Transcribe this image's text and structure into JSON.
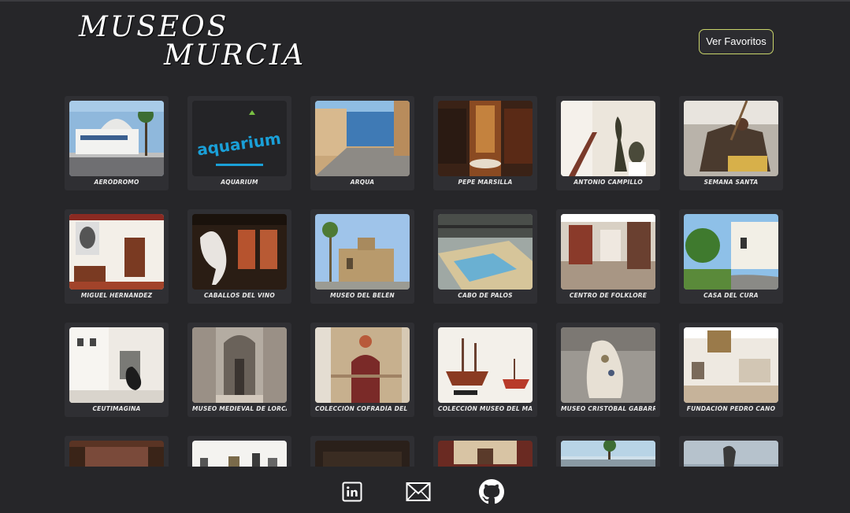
{
  "header": {
    "logo_line1": "MUSEOS",
    "logo_line2": "MURCIA",
    "favorites_button": "Ver Favoritos"
  },
  "gallery": {
    "museums": [
      {
        "label": "AERÓDROMO",
        "icon": "aerodrome-photo"
      },
      {
        "label": "AQUARIUM",
        "icon": "aquarium-logo",
        "logo_text": "aquarium"
      },
      {
        "label": "ARQUA",
        "icon": "arqua-photo"
      },
      {
        "label": "PEPE MARSILLA",
        "icon": "pepe-marsilla-photo"
      },
      {
        "label": "ANTONIO CAMPILLO",
        "icon": "antonio-campillo-photo"
      },
      {
        "label": "SEMANA SANTA",
        "icon": "semana-santa-photo"
      },
      {
        "label": "MIGUEL HERNÁNDEZ",
        "icon": "miguel-hernandez-photo"
      },
      {
        "label": "CABALLOS DEL VINO",
        "icon": "caballos-del-vino-photo"
      },
      {
        "label": "MUSEO DEL BELÉN",
        "icon": "museo-del-belen-photo"
      },
      {
        "label": "CABO DE PALOS",
        "icon": "cabo-de-palos-photo"
      },
      {
        "label": "CENTRO DE FOLKLORE",
        "icon": "centro-de-folklore-photo"
      },
      {
        "label": "CASA DEL CURA",
        "icon": "casa-del-cura-photo"
      },
      {
        "label": "CEUTIMAGINA",
        "icon": "ceutimagina-photo"
      },
      {
        "label": "MUSEO MEDIEVAL DE LORCA",
        "icon": "museo-medieval-lorca-photo"
      },
      {
        "label": "COLECCIÓN COFRADÍA DEL ROLLO",
        "icon": "cofradia-del-rollo-photo"
      },
      {
        "label": "COLECCIÓN MUSEO DEL MAR",
        "icon": "museo-del-mar-photo"
      },
      {
        "label": "MUSEO CRISTÓBAL GABARRÓN",
        "icon": "cristobal-gabarron-photo"
      },
      {
        "label": "FUNDACIÓN PEDRO CANO",
        "icon": "pedro-cano-photo"
      },
      {
        "label": "",
        "icon": "museum-photo-19"
      },
      {
        "label": "",
        "icon": "museum-photo-20"
      },
      {
        "label": "",
        "icon": "museum-photo-21"
      },
      {
        "label": "",
        "icon": "museum-photo-22"
      },
      {
        "label": "",
        "icon": "museum-photo-23"
      },
      {
        "label": "",
        "icon": "museum-photo-24"
      }
    ]
  },
  "footer": {
    "icons": [
      "linkedin-icon",
      "mail-icon",
      "github-icon"
    ]
  },
  "colors": {
    "background": "#262629",
    "card": "#2f2f33",
    "button_border": "#c9d46a"
  }
}
